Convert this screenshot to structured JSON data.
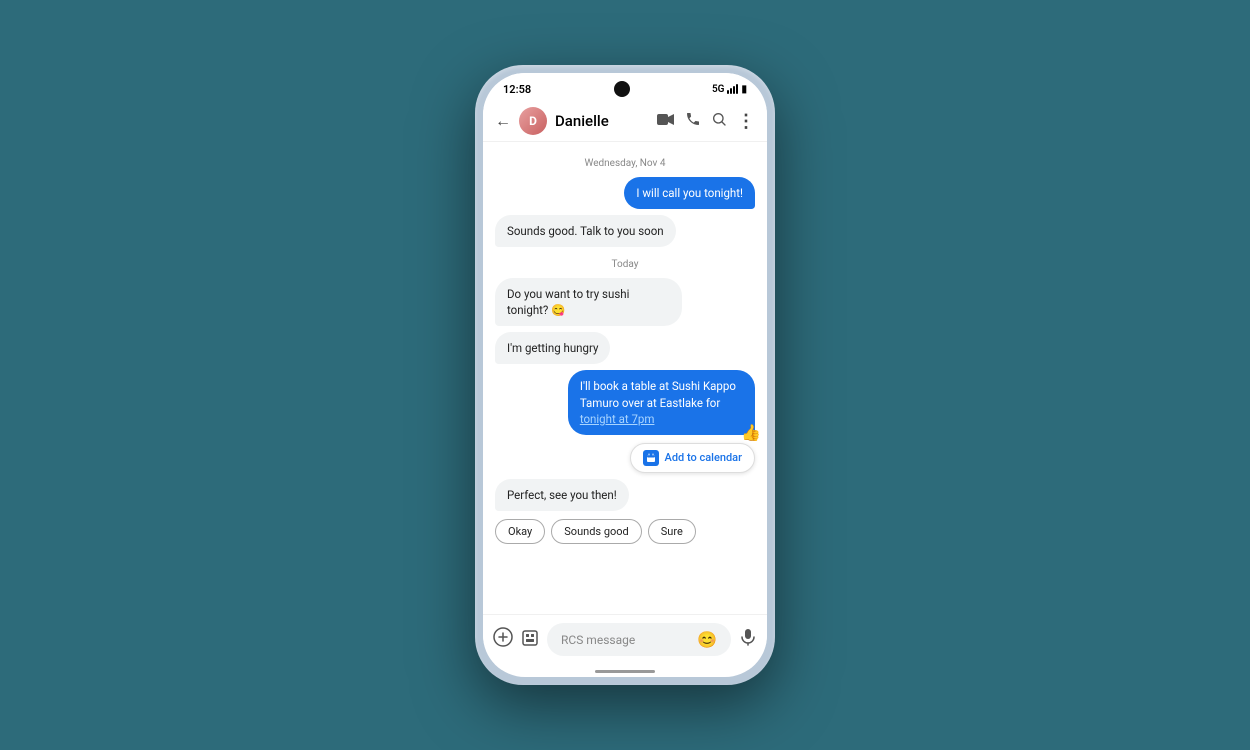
{
  "statusBar": {
    "time": "12:58",
    "network": "5G"
  },
  "appBar": {
    "contactName": "Danielle",
    "backLabel": "←",
    "avatarInitial": "D"
  },
  "chat": {
    "dateSeparators": {
      "past": "Wednesday, Nov 4",
      "today": "Today"
    },
    "messages": [
      {
        "id": "m1",
        "type": "sent",
        "text": "I will call you tonight!"
      },
      {
        "id": "m2",
        "type": "received",
        "text": "Sounds good. Talk to you soon"
      },
      {
        "id": "m3",
        "type": "received",
        "text": "Do you want to try sushi tonight? 😋"
      },
      {
        "id": "m4",
        "type": "received",
        "text": "I'm getting hungry"
      },
      {
        "id": "m5",
        "type": "sent-link",
        "text": "I'll book a table at Sushi Kappo Tamuro over at Eastlake for ",
        "linkText": "tonight at 7pm",
        "hasThumb": true
      },
      {
        "id": "m6",
        "type": "calendar-chip",
        "text": "Add to calendar"
      },
      {
        "id": "m7",
        "type": "received",
        "text": "Perfect, see you then!"
      }
    ],
    "quickReplies": [
      {
        "id": "qr1",
        "label": "Okay"
      },
      {
        "id": "qr2",
        "label": "Sounds good"
      },
      {
        "id": "qr3",
        "label": "Sure"
      }
    ]
  },
  "inputBar": {
    "placeholder": "RCS message",
    "addIcon": "+",
    "attachIcon": "⊡",
    "emojiIcon": "😊",
    "micIcon": "🎤"
  },
  "icons": {
    "videoCall": "📹",
    "phone": "📞",
    "search": "🔍",
    "more": "⋮",
    "calendar": "📅",
    "thumbsUp": "👍"
  }
}
